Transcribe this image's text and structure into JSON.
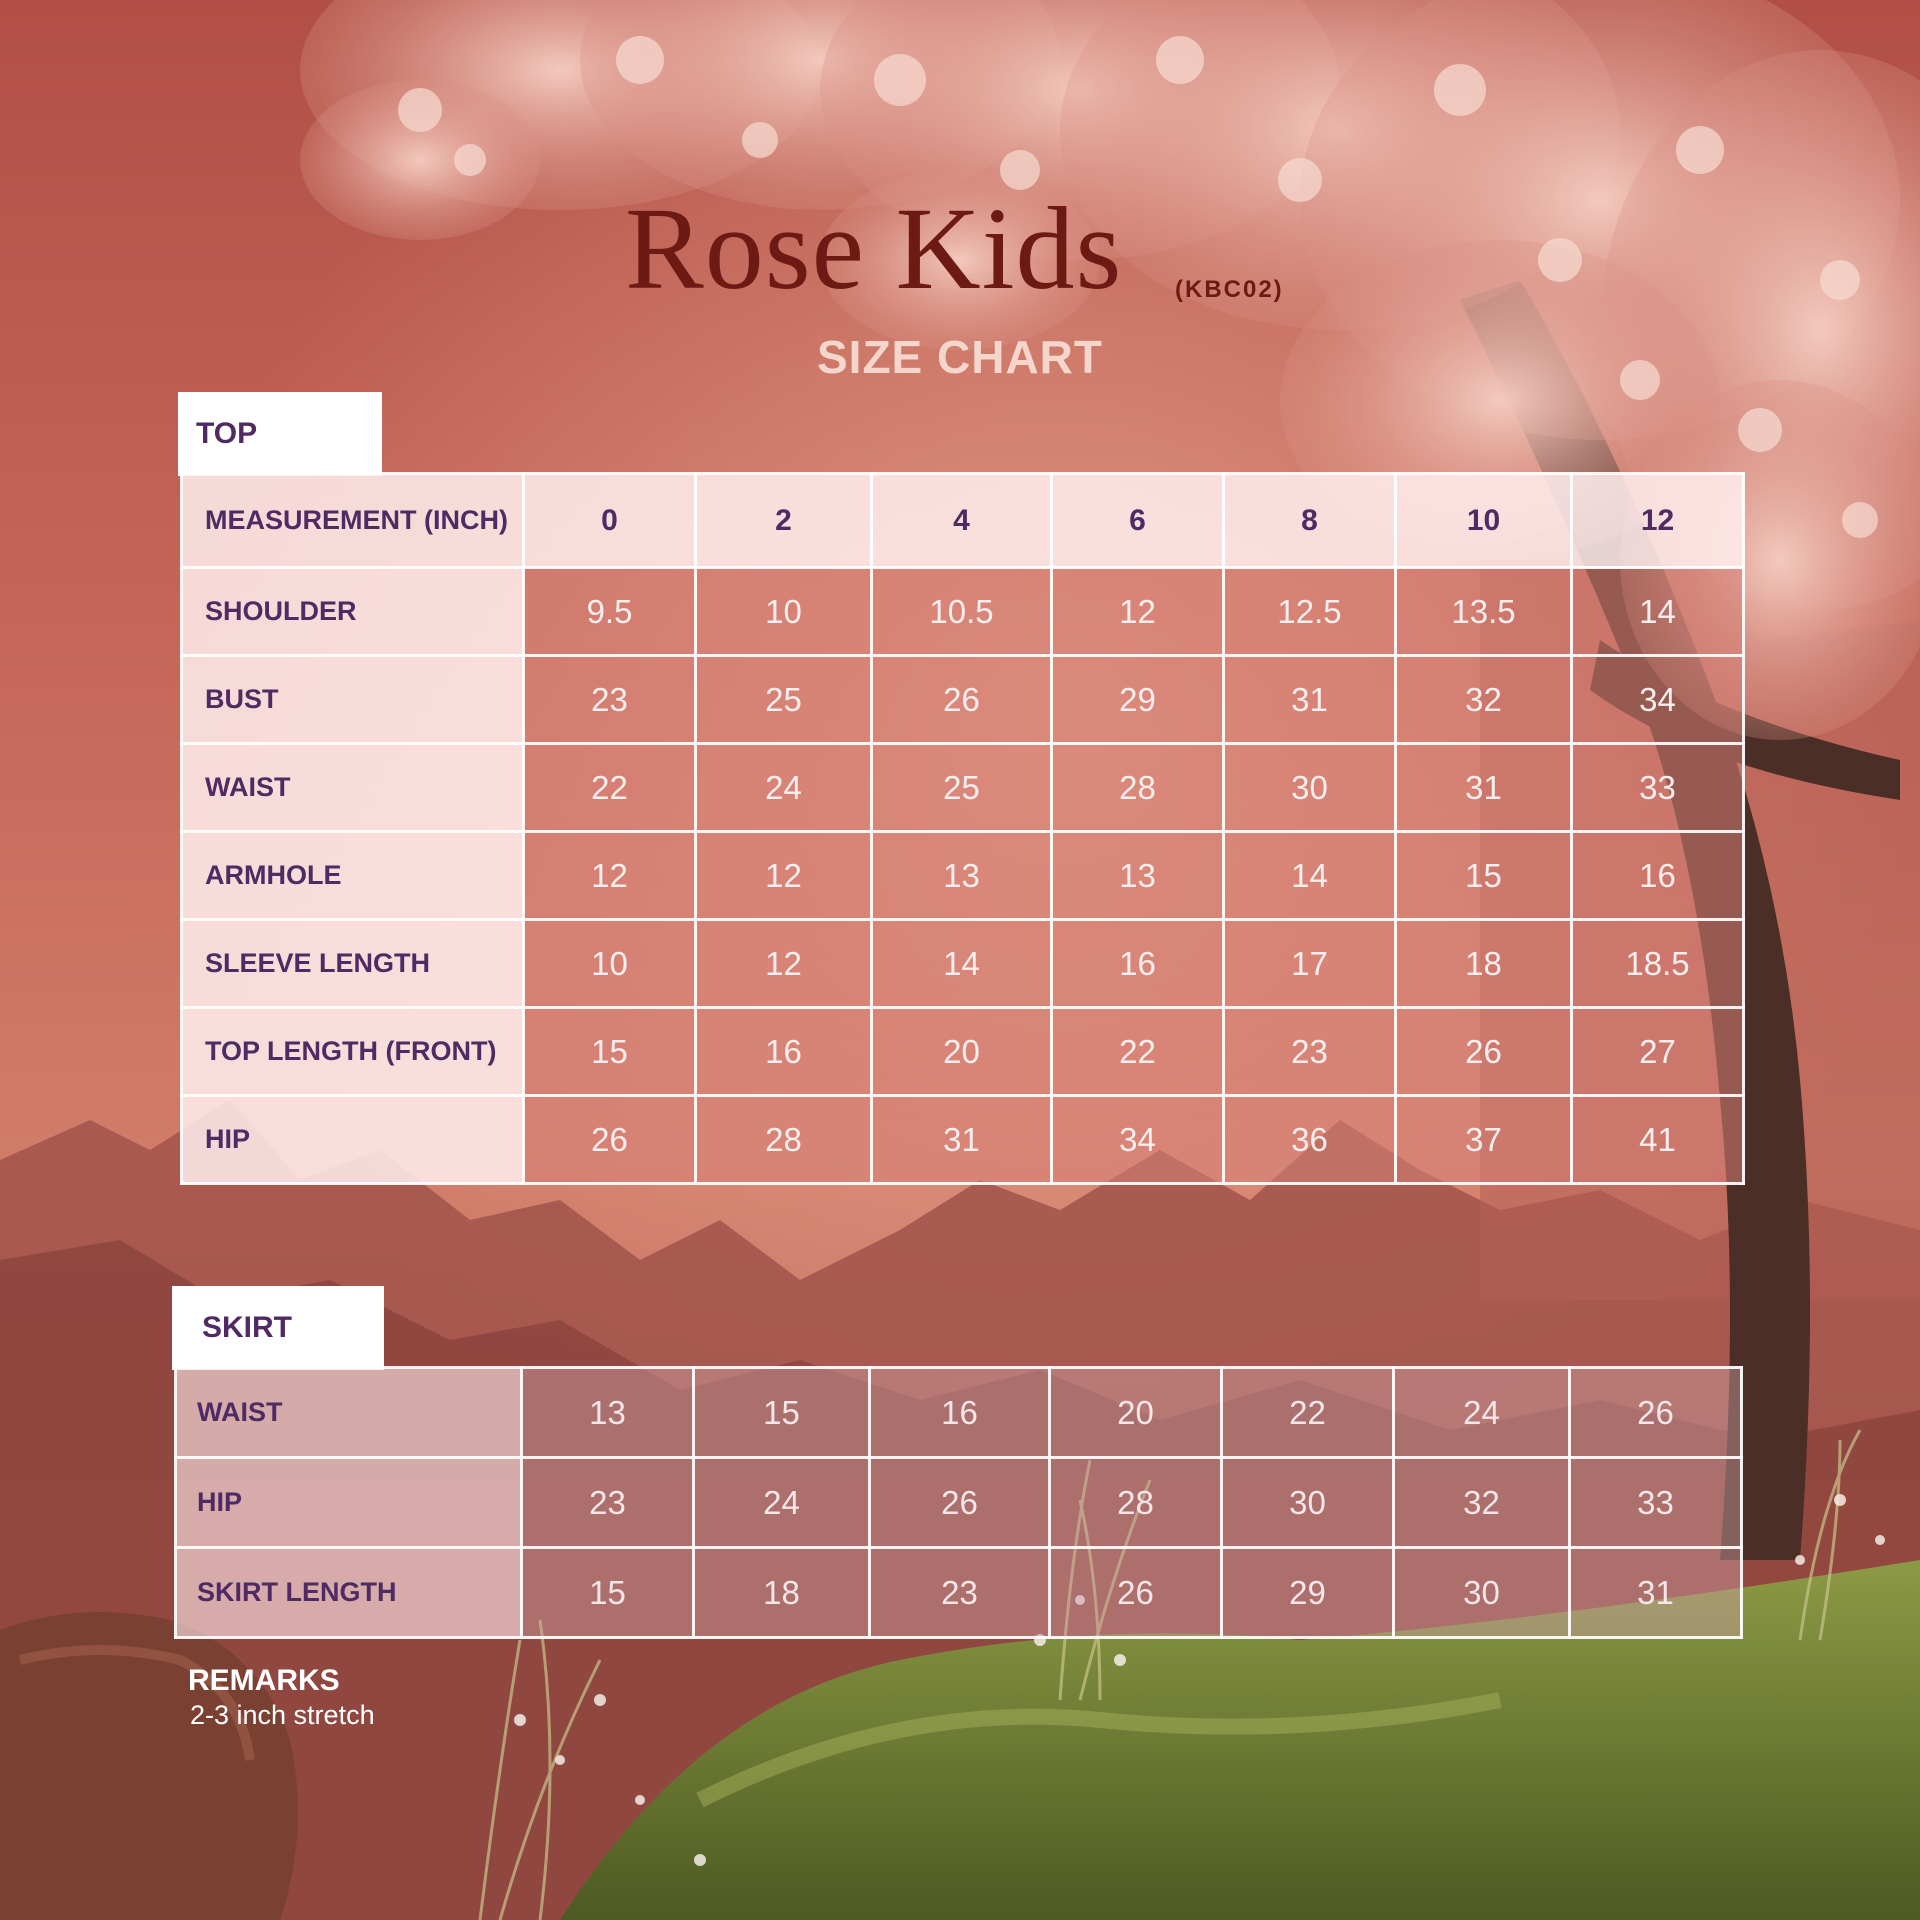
{
  "header": {
    "title": "Rose Kids",
    "code": "(KBC02)",
    "subtitle": "SIZE CHART"
  },
  "top": {
    "tab_label": "TOP",
    "header_label": "MEASUREMENT (INCH)",
    "sizes": [
      "0",
      "2",
      "4",
      "6",
      "8",
      "10",
      "12"
    ],
    "rows": [
      {
        "label": "SHOULDER",
        "values": [
          "9.5",
          "10",
          "10.5",
          "12",
          "12.5",
          "13.5",
          "14"
        ]
      },
      {
        "label": "BUST",
        "values": [
          "23",
          "25",
          "26",
          "29",
          "31",
          "32",
          "34"
        ]
      },
      {
        "label": "WAIST",
        "values": [
          "22",
          "24",
          "25",
          "28",
          "30",
          "31",
          "33"
        ]
      },
      {
        "label": "ARMHOLE",
        "values": [
          "12",
          "12",
          "13",
          "13",
          "14",
          "15",
          "16"
        ]
      },
      {
        "label": "SLEEVE LENGTH",
        "values": [
          "10",
          "12",
          "14",
          "16",
          "17",
          "18",
          "18.5"
        ]
      },
      {
        "label": "TOP LENGTH (FRONT)",
        "values": [
          "15",
          "16",
          "20",
          "22",
          "23",
          "26",
          "27"
        ]
      },
      {
        "label": "HIP",
        "values": [
          "26",
          "28",
          "31",
          "34",
          "36",
          "37",
          "41"
        ]
      }
    ]
  },
  "skirt": {
    "tab_label": "SKIRT",
    "rows": [
      {
        "label": "WAIST",
        "values": [
          "13",
          "15",
          "16",
          "20",
          "22",
          "24",
          "26"
        ]
      },
      {
        "label": "HIP",
        "values": [
          "23",
          "24",
          "26",
          "28",
          "30",
          "32",
          "33"
        ]
      },
      {
        "label": "SKIRT LENGTH",
        "values": [
          "15",
          "18",
          "23",
          "26",
          "29",
          "30",
          "31"
        ]
      }
    ]
  },
  "remarks": {
    "title": "REMARKS",
    "text": "2-3 inch stretch"
  },
  "colors": {
    "title": "#6e1a14",
    "label_text": "#4f2a63",
    "sky": "#c2665a",
    "mountains": "#9c4f48",
    "moss": "#6f7a34",
    "blossom": "#e7aea2"
  }
}
